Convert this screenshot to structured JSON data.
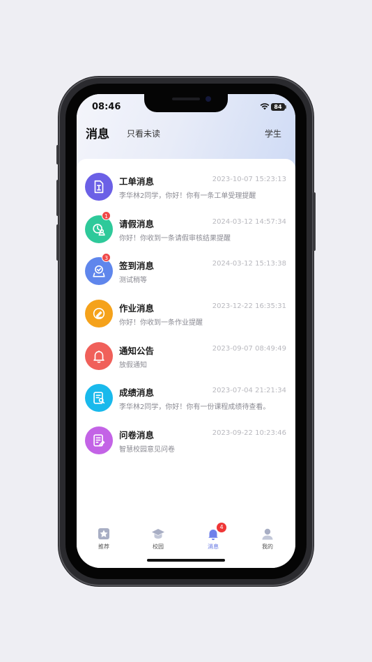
{
  "status_bar": {
    "time": "08:46",
    "battery": "84"
  },
  "header": {
    "title": "消息",
    "filter_label": "只看未读",
    "role_label": "学生"
  },
  "messages": [
    {
      "title": "工单消息",
      "time": "2023-10-07 15:23:13",
      "preview": "李华林2同学，你好！你有一条工单受理提醒",
      "color": "#6b60e6",
      "icon": "work-order-icon",
      "badge": ""
    },
    {
      "title": "请假消息",
      "time": "2024-03-12 14:57:34",
      "preview": "你好！你收到一条请假审核结果提醒",
      "color": "#2ec99a",
      "icon": "leave-icon",
      "badge": "1"
    },
    {
      "title": "签到消息",
      "time": "2024-03-12 15:13:38",
      "preview": "测试稍等",
      "color": "#5f86ec",
      "icon": "check-in-icon",
      "badge": "3"
    },
    {
      "title": "作业消息",
      "time": "2023-12-22 16:35:31",
      "preview": "你好！你收到一条作业提醒",
      "color": "#f5a21b",
      "icon": "homework-icon",
      "badge": ""
    },
    {
      "title": "通知公告",
      "time": "2023-09-07 08:49:49",
      "preview": "放假通知",
      "color": "#f0605a",
      "icon": "bell-icon",
      "badge": ""
    },
    {
      "title": "成绩消息",
      "time": "2023-07-04 21:21:34",
      "preview": "李华林2同学，你好！你有一份课程成绩待查看。",
      "color": "#19b9ec",
      "icon": "grade-icon",
      "badge": ""
    },
    {
      "title": "问卷消息",
      "time": "2023-09-22 10:23:46",
      "preview": "智慧校园意见问卷",
      "color": "#c363e6",
      "icon": "survey-icon",
      "badge": ""
    }
  ],
  "tabbar": {
    "tabs": [
      {
        "label": "推荐",
        "icon": "star-icon"
      },
      {
        "label": "校园",
        "icon": "graduation-cap-icon"
      },
      {
        "label": "消息",
        "icon": "bell-icon",
        "badge": "4",
        "active": true
      },
      {
        "label": "我的",
        "icon": "user-icon"
      }
    ]
  }
}
